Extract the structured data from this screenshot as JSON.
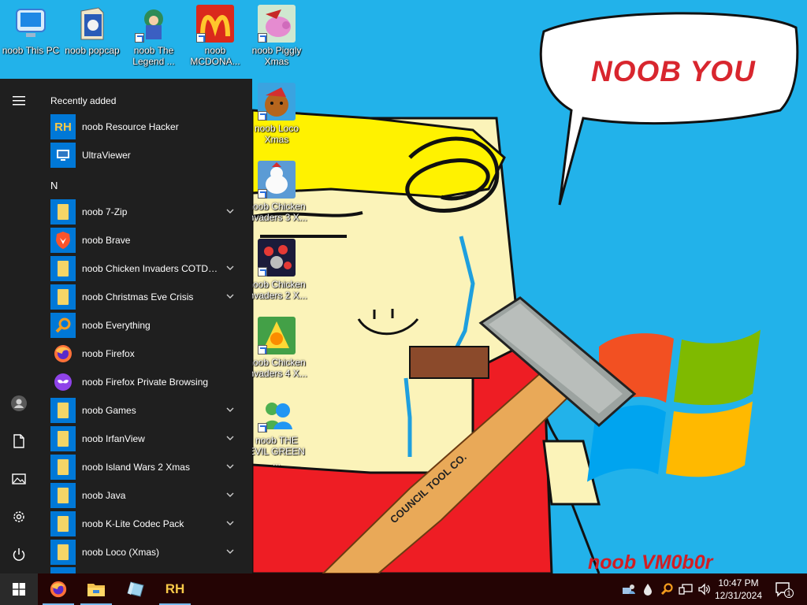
{
  "wallpaper": {
    "bubble_text": "NOOB YOU",
    "signature": "noob VM0b0r",
    "hammer_text": "COUNCIL TOOL CO."
  },
  "desktop": {
    "icons": [
      {
        "label": "noob This PC",
        "icon": "this-pc-icon"
      },
      {
        "label": "noob popcap",
        "icon": "popcap-icon"
      },
      {
        "label": "noob The Legend ...",
        "icon": "legend-game-icon"
      },
      {
        "label": "noob MCDONA...",
        "icon": "mcdonalds-icon"
      },
      {
        "label": "noob Piggly Xmas",
        "icon": "piggly-icon"
      },
      {
        "label": "noob Loco Xmas",
        "icon": "loco-bear-icon"
      },
      {
        "label": "noob Chicken Invaders 3 X...",
        "icon": "chicken-invaders-3-icon"
      },
      {
        "label": "noob Chicken Invaders 2 X...",
        "icon": "chicken-invaders-2-icon"
      },
      {
        "label": "noob Chicken Invaders 4 X...",
        "icon": "chicken-invaders-4-icon"
      },
      {
        "label": "noob THE EVIL GREEN ...",
        "icon": "evil-green-icon"
      }
    ]
  },
  "start_menu": {
    "recently_added_header": "Recently added",
    "recent_apps": [
      {
        "label": "noob Resource Hacker",
        "icon": "resource-hacker-icon"
      },
      {
        "label": "UltraViewer",
        "icon": "ultraviewer-icon"
      }
    ],
    "letter_header": "N",
    "apps": [
      {
        "label": "noob 7-Zip",
        "icon": "folder-icon",
        "expandable": true
      },
      {
        "label": "noob Brave",
        "icon": "brave-icon",
        "expandable": false
      },
      {
        "label": "noob Chicken Invaders COTDS X...",
        "icon": "folder-icon",
        "expandable": true
      },
      {
        "label": "noob Christmas Eve Crisis",
        "icon": "folder-icon",
        "expandable": true
      },
      {
        "label": "noob Everything",
        "icon": "everything-search-icon",
        "expandable": false
      },
      {
        "label": "noob Firefox",
        "icon": "firefox-icon",
        "expandable": false
      },
      {
        "label": "noob Firefox Private Browsing",
        "icon": "firefox-private-icon",
        "expandable": false
      },
      {
        "label": "noob Games",
        "icon": "folder-icon",
        "expandable": true
      },
      {
        "label": "noob IrfanView",
        "icon": "folder-icon",
        "expandable": true
      },
      {
        "label": "noob Island Wars 2 Xmas",
        "icon": "folder-icon",
        "expandable": true
      },
      {
        "label": "noob Java",
        "icon": "folder-icon",
        "expandable": true
      },
      {
        "label": "noob K-Lite Codec Pack",
        "icon": "folder-icon",
        "expandable": true
      },
      {
        "label": "noob Loco (Xmas)",
        "icon": "folder-icon",
        "expandable": true
      }
    ],
    "rail": [
      "hamburger-icon",
      "user-avatar-icon",
      "documents-icon",
      "pictures-icon",
      "settings-icon",
      "power-icon"
    ]
  },
  "taskbar": {
    "start": "windows-logo-icon",
    "apps": [
      "firefox-icon",
      "file-explorer-icon",
      "glass-app-icon",
      "resource-hacker-icon"
    ],
    "tray": [
      "pc-user-tray-icon",
      "drop-tray-icon",
      "search-tray-icon",
      "network-icon",
      "volume-icon"
    ],
    "time": "10:47 PM",
    "date": "12/31/2024",
    "notification_count": "1"
  },
  "colors": {
    "wallpaper_blue": "#22b2ea",
    "start_menu_bg": "#1f1f1f",
    "tile_blue": "#0078d7",
    "taskbar_bg": "#240404",
    "accent_red": "#d8262e"
  }
}
